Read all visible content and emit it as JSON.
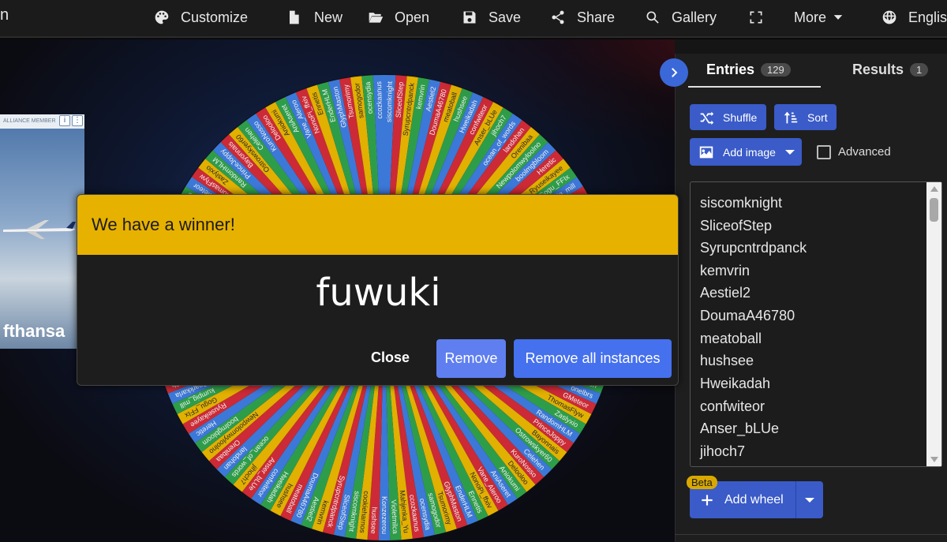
{
  "toolbar": {
    "brand": "n",
    "items": [
      {
        "label": "Customize",
        "icon": "palette-icon"
      },
      {
        "label": "New",
        "icon": "file-icon"
      },
      {
        "label": "Open",
        "icon": "folder-open-icon"
      },
      {
        "label": "Save",
        "icon": "floppy-disk-icon"
      },
      {
        "label": "Share",
        "icon": "share-icon"
      },
      {
        "label": "Gallery",
        "icon": "search-icon"
      },
      {
        "label": "",
        "icon": "fullscreen-icon"
      },
      {
        "label": "More",
        "icon": "chevron-down-icon"
      },
      {
        "label": "Englis",
        "icon": "globe-icon"
      }
    ]
  },
  "ad": {
    "top_text": "ALLIANCE MEMBER",
    "brand_text": "fthansa",
    "plane_text": "Lufthansa"
  },
  "panel": {
    "tabs": [
      {
        "label": "Entries",
        "count": "129"
      },
      {
        "label": "Results",
        "count": "1"
      }
    ],
    "shuffle_label": "Shuffle",
    "sort_label": "Sort",
    "add_image_label": "Add image",
    "advanced_label": "Advanced",
    "entries": [
      "siscomknight",
      "SliceofStep",
      "Syrupcntrdpanck",
      "kemvrin",
      "Aestiel2",
      "DoumaA46780",
      "meatoball",
      "hushsee",
      "Hweikadah",
      "confwiteor",
      "Anser_bLUe",
      "jihoch7"
    ],
    "beta_label": "Beta",
    "add_wheel_label": "Add wheel"
  },
  "dialog": {
    "title": "We have a winner!",
    "winner": "fuwuki",
    "close_label": "Close",
    "remove_label": "Remove",
    "remove_all_label": "Remove all instances"
  },
  "wheel": {
    "colors": [
      "#3c78d8",
      "#cc2a36",
      "#e1b000",
      "#2e9d4a"
    ],
    "labels": [
      "siscomknight",
      "SliceofStep",
      "Syrupcntrdpanck",
      "kemvrin",
      "Aestiel2",
      "DoumaA46780",
      "meatoball",
      "hushsee",
      "Hweikadah",
      "confwiteor",
      "Anser_bLUe",
      "jihoch7",
      "ocean_of_words",
      "landohan",
      "Orenibaa",
      "Newpolomwyloolno",
      "boolmgbloom",
      "Heretic",
      "Ryuseikayee",
      "Gogu_FFIx",
      "kumpig_mill",
      "Sparkkarla",
      "Ja_Cb",
      "FunkDaemon",
      "Guyaszeno",
      "kim_nguyen3423",
      "kd_k_itsbowee",
      "MoffinnR",
      "Syrupcntrdpanck",
      "LightLauren",
      "PrinceJoppy",
      "yuchennames",
      "Sapphire_sku",
      "sun_of_words_",
      "l_ffxiv",
      "fuwuki",
      "Aestiel2",
      "fuflodful",
      "RodeMyouse",
      "LightLauren",
      "onelbrs",
      "GMeteor",
      "ThomasFlyw",
      "Zaslyxio",
      "RandomHLM",
      "PrinceJoppy",
      "Bayonnais",
      "Ostrowskyer60",
      "Celehen",
      "KuroNosso",
      "Delooloo",
      "Aniokumi",
      "AniAseret",
      "Vane_Aleroo",
      "NonoPi_ffxiv",
      "Ennetis",
      "EnderHLM",
      "GlyphMaston",
      "Tsumorimy",
      "samogodor",
      "ocensydia",
      "ccozkaanus",
      "Mahjenka_Yu",
      "Violetmilca",
      "Konzezerou",
      "hushsee",
      "cookieharnos"
    ]
  }
}
